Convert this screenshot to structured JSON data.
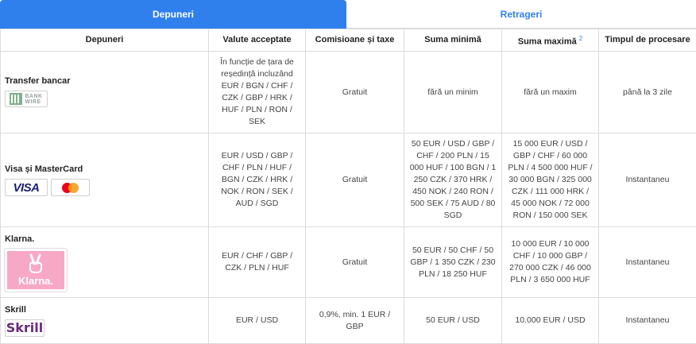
{
  "tabs": {
    "deposits": "Depuneri",
    "withdrawals": "Retrageri"
  },
  "table": {
    "headers": {
      "method": "Depuneri",
      "currencies": "Valute acceptate",
      "fees": "Comisioane și taxe",
      "min": "Suma minimă",
      "max": "Suma maximă",
      "max_note": "2",
      "time": "Timpul de procesare"
    },
    "rows": [
      {
        "name": "Transfer bancar",
        "logo_text_1": "BANK",
        "logo_text_2": "WIRE",
        "currencies": "În funcție de țara de reședință incluzând EUR / BGN / CHF / CZK / GBP / HRK / HUF / PLN / RON / SEK",
        "fees": "Gratuit",
        "min": "fără un minim",
        "max": "fără un maxim",
        "time": "până la 3 zile"
      },
      {
        "name": "Visa și MasterCard",
        "logo_text_1": "VISA",
        "currencies": "EUR / USD / GBP / CHF / PLN / HUF / BGN / CZK / HRK / NOK / RON / SEK / AUD / SGD",
        "fees": "Gratuit",
        "min": "50 EUR / USD / GBP / CHF / 200 PLN / 15 000 HUF / 100 BGN / 1 250 CZK / 370 HRK / 450 NOK / 240 RON / 500 SEK / 75 AUD / 80 SGD",
        "max": "15 000 EUR / USD / GBP / CHF / 60 000 PLN / 4 500 000 HUF / 30 000 BGN / 325 000 CZK / 111 000 HRK / 45 000 NOK / 72 000 RON / 150 000 SEK",
        "time": "Instantaneu"
      },
      {
        "name": "Klarna.",
        "logo_text_1": "Klarna.",
        "currencies": "EUR / CHF / GBP / CZK / PLN / HUF",
        "fees": "Gratuit",
        "min": "50 EUR / 50 CHF / 50 GBP / 1 350 CZK / 230 PLN / 18 250 HUF",
        "max": "10 000 EUR / 10 000 CHF / 10 000 GBP / 270 000 CZK / 46 000 PLN / 3 650 000 HUF",
        "time": "Instantaneu"
      },
      {
        "name": "Skrill",
        "logo_text_1": "Skrill",
        "currencies": "EUR / USD",
        "fees": "0,9%, min. 1 EUR / GBP",
        "min": "50 EUR / USD",
        "max": "10.000 EUR / USD",
        "time": "Instantaneu"
      }
    ]
  },
  "colors": {
    "accent": "#2f80ed",
    "klarna_pink": "#f7a8c4",
    "skrill_purple": "#6b2b7e",
    "visa_blue": "#1a1f71"
  },
  "icons": [
    "bank-wire-logo-icon",
    "visa-logo-icon",
    "mastercard-logo-icon",
    "klarna-logo-icon",
    "skrill-logo-icon"
  ]
}
